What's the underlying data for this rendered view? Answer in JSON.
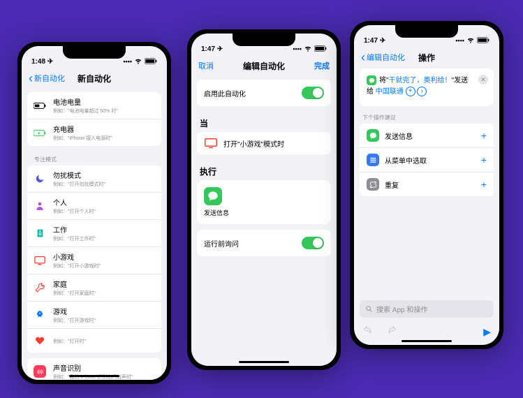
{
  "phone1": {
    "time": "1:48",
    "back": "新自动化",
    "title": "新自动化",
    "groups": {
      "top": [
        {
          "icon": "battery",
          "title": "电池电量",
          "sub": "例如：\"电池电量超过 50% 时\""
        },
        {
          "icon": "charger",
          "title": "充电器",
          "sub": "例如：\"iPhone 接入电源时\""
        }
      ],
      "focus_label": "专注模式",
      "focus": [
        {
          "icon": "moon",
          "color": "#5856d6",
          "title": "勿扰模式",
          "sub": "例如：\"打开勿扰模式时\""
        },
        {
          "icon": "person",
          "color": "#af52de",
          "title": "个人",
          "sub": "例如：\"打开个人时\""
        },
        {
          "icon": "work",
          "color": "#04b5a5",
          "title": "工作",
          "sub": "例如：\"打开工作时\""
        },
        {
          "icon": "display",
          "color": "#ff3b30",
          "title": "小游戏",
          "sub": "例如：\"打开小游戏时\""
        },
        {
          "icon": "wrench",
          "color": "#ff3b30",
          "title": "家庭",
          "sub": "例如：\"打开家庭时\""
        },
        {
          "icon": "rocket",
          "color": "#007aff",
          "title": "游戏",
          "sub": "例如：\"打开游戏时\""
        },
        {
          "icon": "heart",
          "color": "#ff3b30",
          "title": "",
          "sub": "例如：\"打开时\""
        }
      ],
      "sound": [
        {
          "icon": "sound",
          "color": "#ff3b59",
          "title": "声音识别",
          "sub": "例如：\"我的 iPhone 识别出门铃声时\""
        }
      ]
    }
  },
  "phone2": {
    "time": "1:47",
    "cancel": "取消",
    "title": "编辑自动化",
    "done": "完成",
    "enable_label": "启用此自动化",
    "when": "当",
    "condition": "打开\"小游戏\"模式时",
    "do": "执行",
    "action": "发送信息",
    "ask": "运行前询问"
  },
  "phone3": {
    "time": "1:47",
    "back": "编辑自动化",
    "title": "操作",
    "macro": {
      "pre1": "将\"",
      "msg": "干就完了，奥利给！",
      "post1": "\"发送",
      "pre2": "给",
      "recipient": "中国联通"
    },
    "sugg_label": "下个操作建议",
    "sugg": [
      {
        "label": "发送信息",
        "bg": "#34c759",
        "icon": "bubble"
      },
      {
        "label": "从菜单中选取",
        "bg": "#3478f6",
        "icon": "list"
      },
      {
        "label": "重复",
        "bg": "#8e8e93",
        "icon": "repeat"
      }
    ],
    "search": "搜索 App 和操作"
  }
}
